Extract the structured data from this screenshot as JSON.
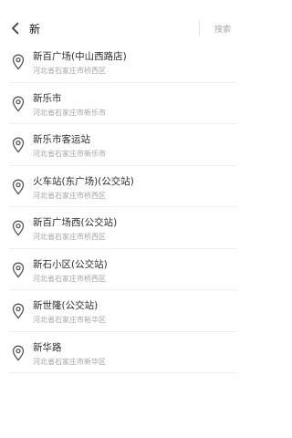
{
  "header": {
    "back_icon": "chevron-left-icon",
    "search_value": "新",
    "search_button_label": "搜索"
  },
  "results": [
    {
      "name": "新百广场(中山西路店)",
      "address": "河北省石家庄市桥西区"
    },
    {
      "name": "新乐市",
      "address": "河北省石家庄市新乐市"
    },
    {
      "name": "新乐市客运站",
      "address": "河北省石家庄市新乐市"
    },
    {
      "name": "火车站(东广场)(公交站)",
      "address": "河北省石家庄市桥西区"
    },
    {
      "name": "新百广场西(公交站)",
      "address": "河北省石家庄市桥西区"
    },
    {
      "name": "新石小区(公交站)",
      "address": "河北省石家庄市桥西区"
    },
    {
      "name": "新世隆(公交站)",
      "address": "河北省石家庄市裕华区"
    },
    {
      "name": "新华路",
      "address": "河北省石家庄市新华区"
    }
  ],
  "icons": {
    "result_icon": "location-pin-icon"
  },
  "colors": {
    "caret": "#e24a6a",
    "title_text": "#2b2b2b",
    "subtitle_text": "#a3a3a3",
    "search_button_text": "#a8a8a8"
  }
}
